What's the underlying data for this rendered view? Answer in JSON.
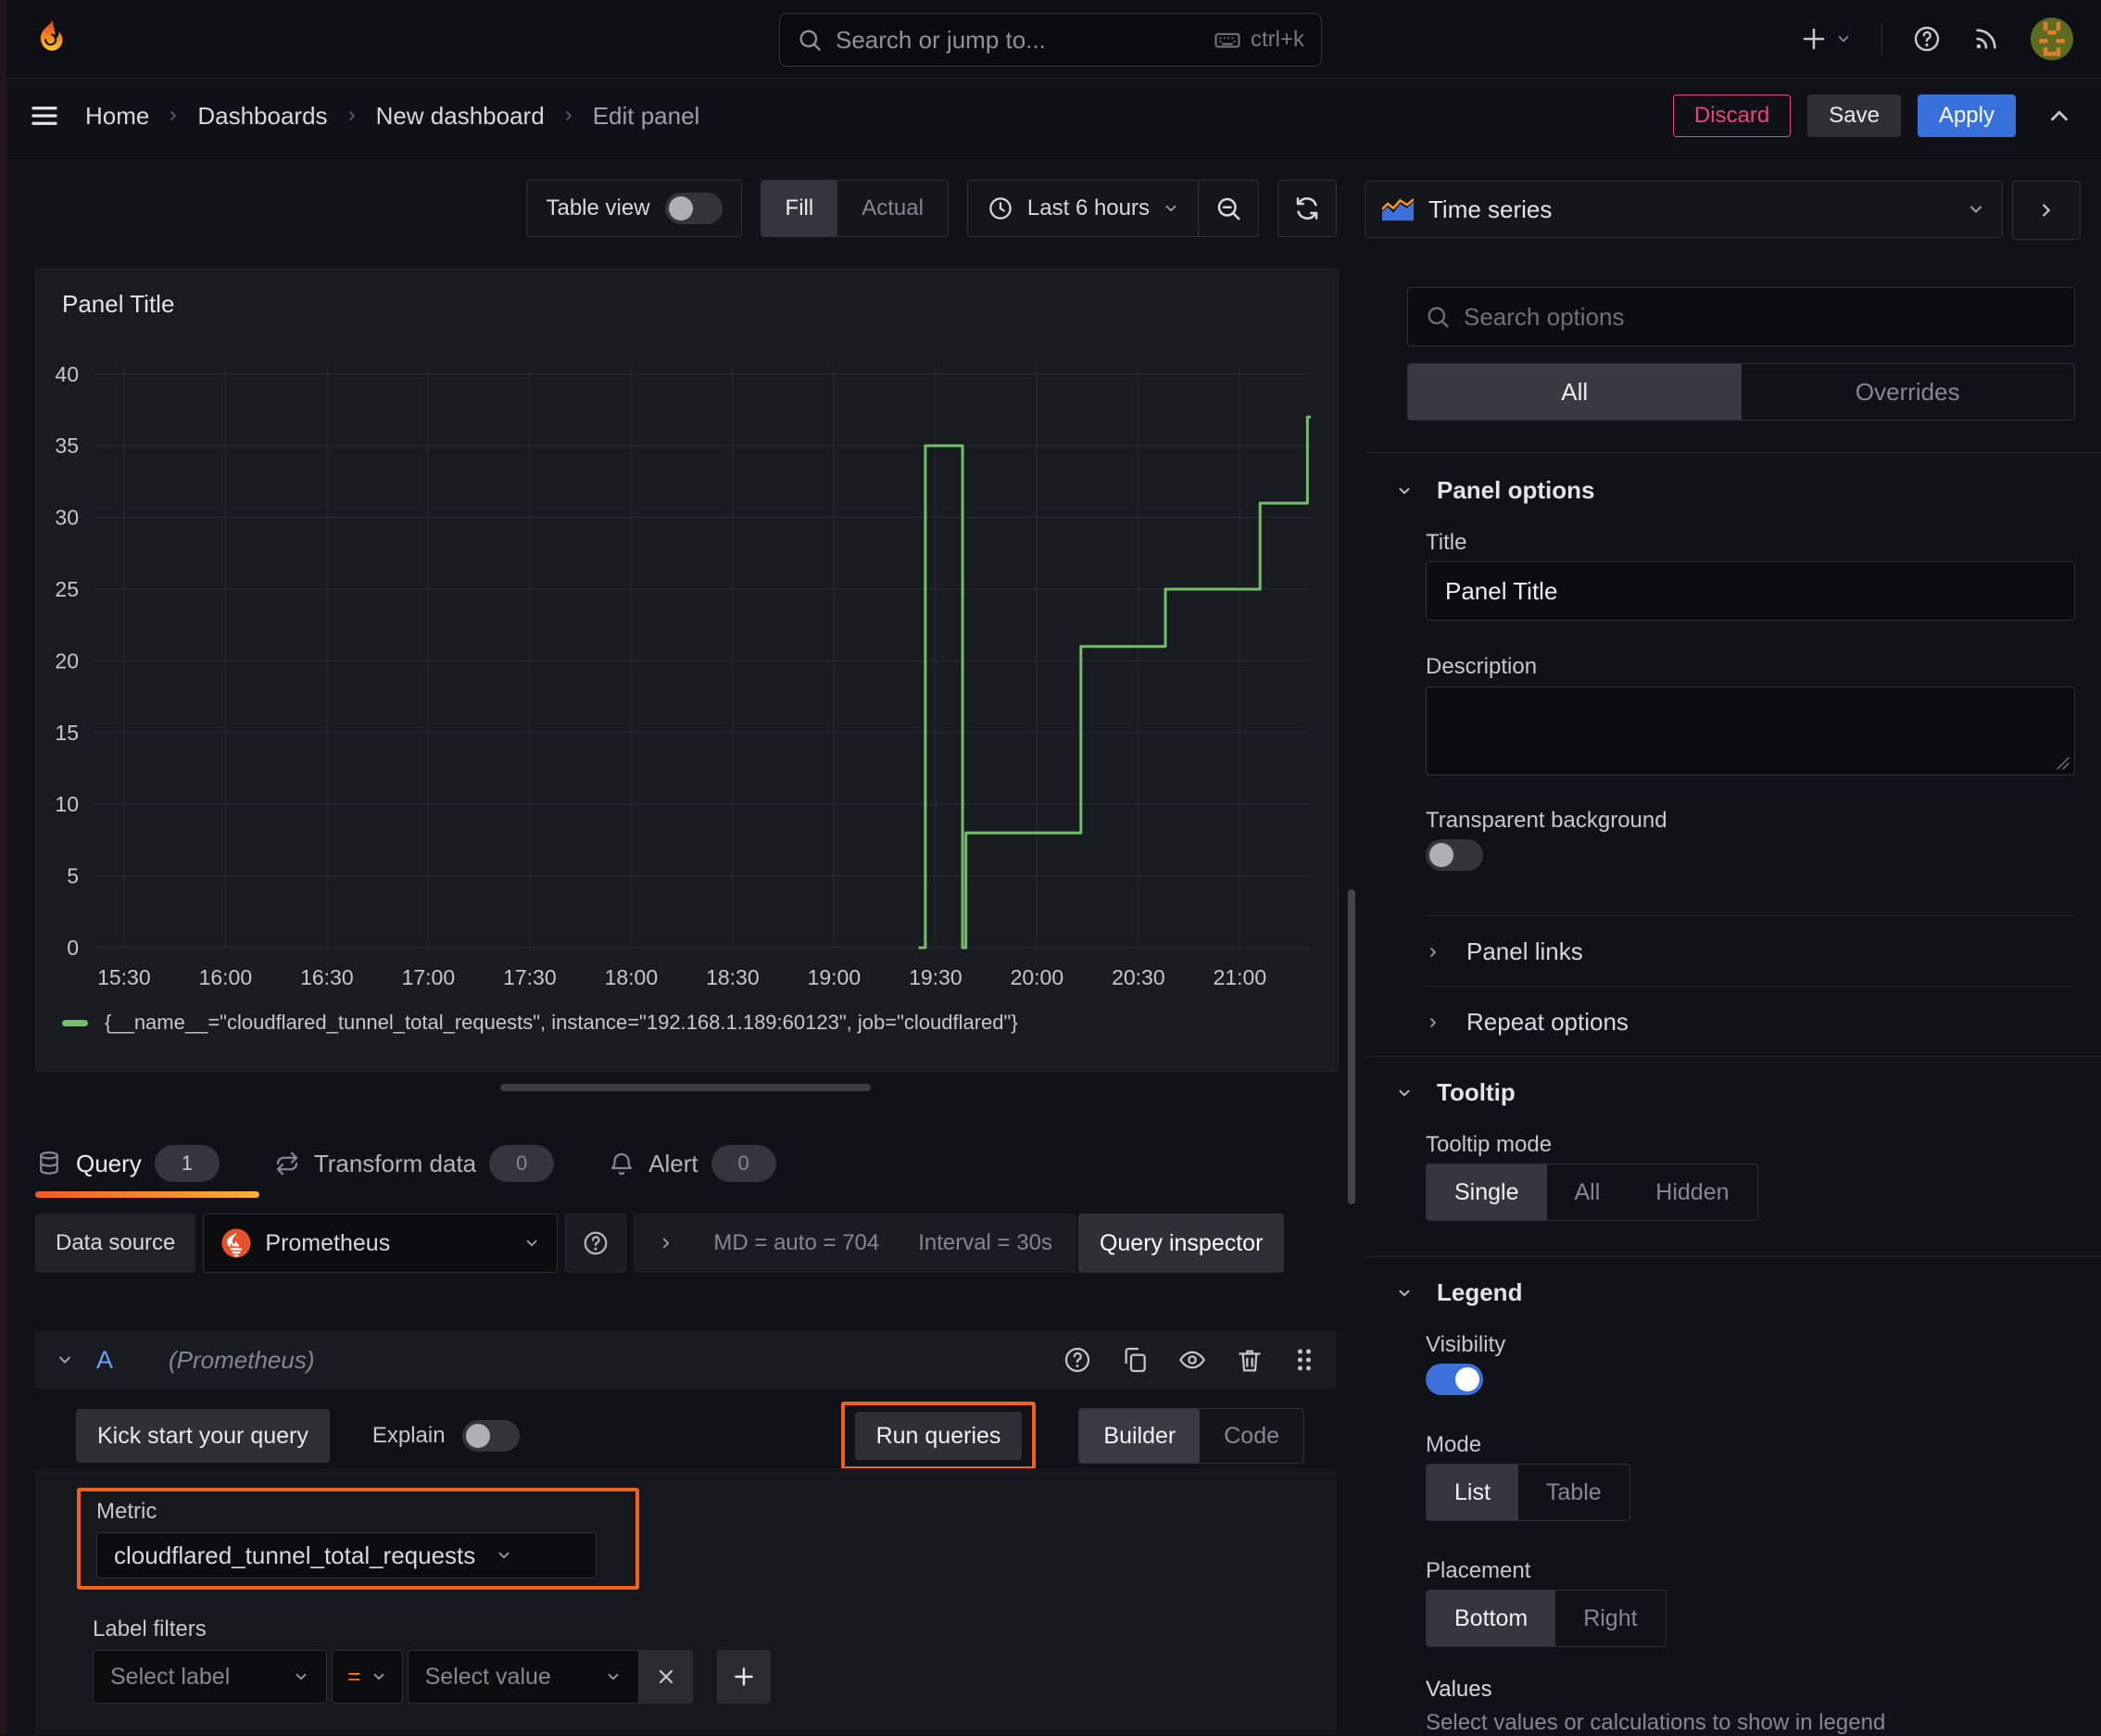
{
  "theme": {
    "accent_orange": "#ff780a",
    "annotation_orange": "#f1611d",
    "primary_blue": "#3871dc",
    "toggle_blue": "#3d71d9",
    "destructive_red": "#e8457c",
    "series_green": "#73bf69",
    "query_ref_blue": "#6e9fff",
    "tab_underline_from": "#f05a28",
    "tab_underline_to": "#f8b133"
  },
  "navbar": {
    "search_placeholder": "Search or jump to...",
    "shortcut": "ctrl+k"
  },
  "breadcrumb": {
    "items": [
      "Home",
      "Dashboards",
      "New dashboard",
      "Edit panel"
    ],
    "discard_label": "Discard",
    "save_label": "Save",
    "apply_label": "Apply"
  },
  "toolbar": {
    "table_view_label": "Table view",
    "fill_label": "Fill",
    "actual_label": "Actual",
    "time_range_label": "Last 6 hours"
  },
  "panel": {
    "title": "Panel Title"
  },
  "chart_data": {
    "type": "line",
    "interpolation": "step-after",
    "title": "Panel Title",
    "xlabel": "",
    "ylabel": "",
    "xlim": [
      "15:21",
      "21:21"
    ],
    "ylim": [
      0,
      40.5
    ],
    "grid": true,
    "legend_position": "bottom",
    "x_ticks": [
      "15:30",
      "16:00",
      "16:30",
      "17:00",
      "17:30",
      "18:00",
      "18:30",
      "19:00",
      "19:30",
      "20:00",
      "20:30",
      "21:00"
    ],
    "y_ticks": [
      0,
      5,
      10,
      15,
      20,
      25,
      30,
      35,
      40
    ],
    "series": [
      {
        "name": "{__name__=\"cloudflared_tunnel_total_requests\", instance=\"192.168.1.189:60123\", job=\"cloudflared\"}",
        "color": "#73bf69",
        "points": [
          [
            "19:25",
            0
          ],
          [
            "19:27",
            0
          ],
          [
            "19:27",
            35
          ],
          [
            "19:38",
            35
          ],
          [
            "19:38",
            0
          ],
          [
            "19:39",
            0
          ],
          [
            "19:39",
            8
          ],
          [
            "20:13",
            8
          ],
          [
            "20:13",
            21
          ],
          [
            "20:38",
            21
          ],
          [
            "20:38",
            25
          ],
          [
            "21:06",
            25
          ],
          [
            "21:06",
            31
          ],
          [
            "21:20",
            31
          ],
          [
            "21:20",
            37
          ],
          [
            "21:21",
            37
          ]
        ]
      }
    ]
  },
  "query_tabs": {
    "query": {
      "label": "Query",
      "count": "1"
    },
    "transform": {
      "label": "Transform data",
      "count": "0"
    },
    "alert": {
      "label": "Alert",
      "count": "0"
    }
  },
  "datasource_row": {
    "label": "Data source",
    "datasource": "Prometheus",
    "stats_md": "MD = auto = 704",
    "stats_interval": "Interval = 30s",
    "inspector_label": "Query inspector"
  },
  "query_editor": {
    "ref_id": "A",
    "ref_note": "(Prometheus)",
    "kick_start_label": "Kick start your query",
    "explain_label": "Explain",
    "run_queries_label": "Run queries",
    "builder_label": "Builder",
    "code_label": "Code",
    "metric_label": "Metric",
    "metric_value": "cloudflared_tunnel_total_requests",
    "label_filters_label": "Label filters",
    "select_label_placeholder": "Select label",
    "operator": "=",
    "select_value_placeholder": "Select value"
  },
  "options_pane": {
    "viz_name": "Time series",
    "search_placeholder": "Search options",
    "filter_all": "All",
    "filter_overrides": "Overrides",
    "panel_options": {
      "header": "Panel options",
      "title_label": "Title",
      "title_value": "Panel Title",
      "description_label": "Description",
      "transparent_label": "Transparent background",
      "panel_links": "Panel links",
      "repeat_options": "Repeat options"
    },
    "tooltip": {
      "header": "Tooltip",
      "mode_label": "Tooltip mode",
      "modes": [
        "Single",
        "All",
        "Hidden"
      ],
      "active_mode": "Single"
    },
    "legend": {
      "header": "Legend",
      "visibility_label": "Visibility",
      "mode_label": "Mode",
      "modes": [
        "List",
        "Table"
      ],
      "active_mode": "List",
      "placement_label": "Placement",
      "placements": [
        "Bottom",
        "Right"
      ],
      "active_placement": "Bottom",
      "values_label": "Values",
      "values_hint": "Select values or calculations to show in legend"
    }
  }
}
